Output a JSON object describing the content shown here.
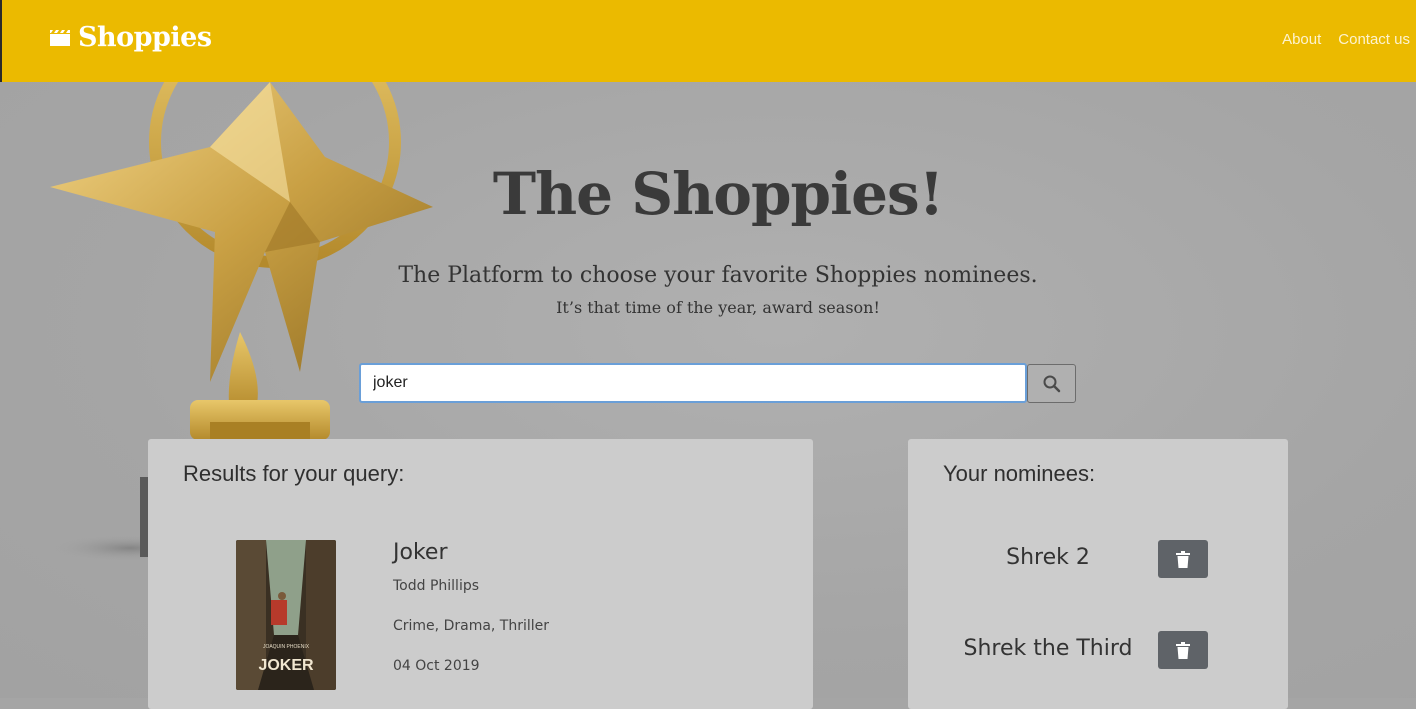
{
  "navbar": {
    "brand_icon": "clapperboard-icon",
    "brand_name": "Shoppies",
    "links": [
      "About",
      "Contact us"
    ]
  },
  "hero": {
    "title": "The Shoppies!",
    "subtitle": "The Platform to choose your favorite Shoppies nominees.",
    "tagline": "It’s that time of the year, award season!"
  },
  "search": {
    "value": "joker",
    "button_icon": "search-icon"
  },
  "results": {
    "heading": "Results for your query:",
    "items": [
      {
        "title": "Joker",
        "director": "Todd Phillips",
        "genre": "Crime, Drama, Thriller",
        "released": "04 Oct 2019",
        "poster_text": "JOKER",
        "poster_top_text": "JOAQUIN PHOENIX"
      }
    ]
  },
  "nominees": {
    "heading": "Your nominees:",
    "items": [
      {
        "title": "Shrek 2",
        "action_icon": "trash-icon"
      },
      {
        "title": "Shrek the Third",
        "action_icon": "trash-icon"
      }
    ]
  },
  "colors": {
    "navbar": "#ebba00",
    "background": "#a5a5a5",
    "panel": "#cccccc",
    "delete_button": "#5f6368",
    "search_focus": "#6a9fd8"
  }
}
